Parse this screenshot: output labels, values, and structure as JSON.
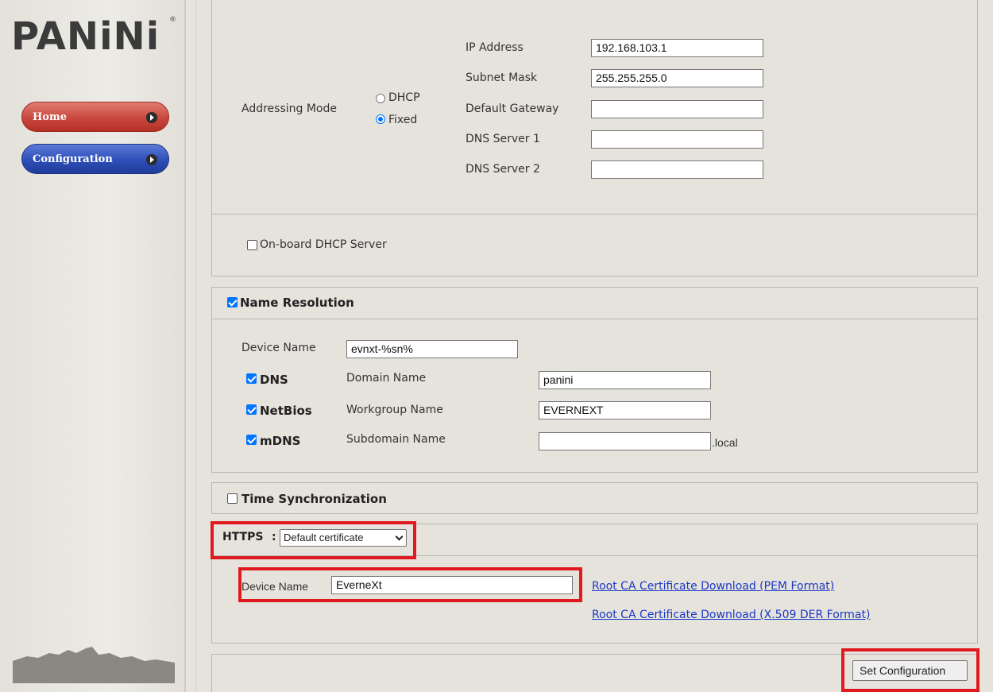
{
  "sidebar": {
    "logo": "PANiNi",
    "logo_mark": "®",
    "nav": [
      {
        "label": "Home",
        "color": "#c8483d"
      },
      {
        "label": "Configuration",
        "color": "#2d4fb8"
      }
    ]
  },
  "addressing": {
    "mode_label": "Addressing Mode",
    "options": [
      {
        "label": "DHCP",
        "selected": false
      },
      {
        "label": "Fixed",
        "selected": true
      }
    ],
    "fields": [
      {
        "label": "IP Address",
        "value": "192.168.103.1"
      },
      {
        "label": "Subnet Mask",
        "value": "255.255.255.0"
      },
      {
        "label": "Default Gateway",
        "value": ""
      },
      {
        "label": "DNS Server 1",
        "value": ""
      },
      {
        "label": "DNS Server 2",
        "value": ""
      }
    ]
  },
  "dhcp_server": {
    "label": "On-board DHCP Server",
    "checked": false
  },
  "name_resolution": {
    "title": "Name Resolution",
    "checked": true,
    "device_name_label": "Device Name",
    "device_name_value": "evnxt-%sn%",
    "rows": [
      {
        "proto": "DNS",
        "checked": true,
        "label": "Domain Name",
        "value": "panini",
        "suffix": ""
      },
      {
        "proto": "NetBios",
        "checked": true,
        "label": "Workgroup Name",
        "value": "EVERNEXT",
        "suffix": ""
      },
      {
        "proto": "mDNS",
        "checked": true,
        "label": "Subdomain Name",
        "value": "",
        "suffix": ".local"
      }
    ]
  },
  "time_sync": {
    "title": "Time Synchronization",
    "checked": false
  },
  "https": {
    "label": "HTTPS",
    "colon": ":",
    "selected": "Default certificate",
    "device_name_label": "Device Name",
    "device_name_value": "EverneXt",
    "links": [
      "Root CA Certificate Download (PEM Format)",
      "Root CA Certificate Download (X.509 DER Format)"
    ]
  },
  "actions": {
    "set_configuration": "Set Configuration"
  },
  "highlight_color": "#e0191f"
}
